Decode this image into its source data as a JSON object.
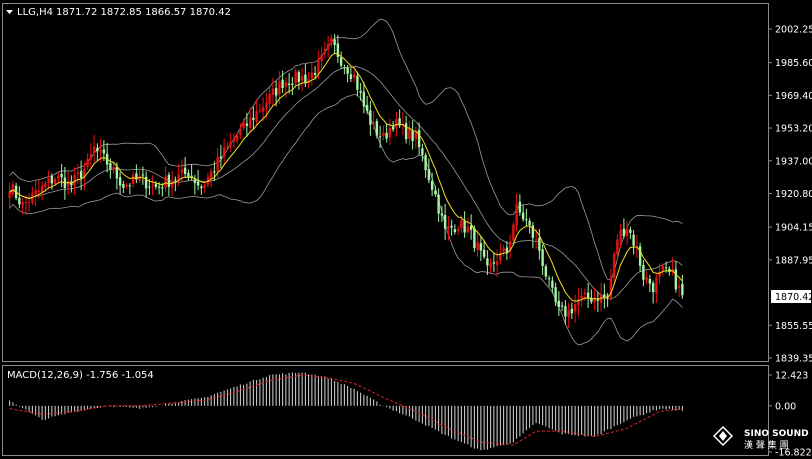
{
  "header": {
    "symbol_label": "LLG,H4",
    "ohlc": "1871.72 1872.85 1866.57 1870.42"
  },
  "macd_header": {
    "label": "MACD(12,26,9) -1.756 -1.054"
  },
  "watermark": {
    "brand": "SINO SOUND",
    "chinese": "漢 聲 集 團"
  },
  "colors": {
    "background": "#000000",
    "frame": "#8a8a8a",
    "bull": "#e81010",
    "bear": "#a6f5a6",
    "ma": "#f0e020",
    "bands": "#9a9a9a",
    "macd_hist": "#d8d8d8",
    "macd_signal": "#e02020",
    "price_box": "#ffffff"
  },
  "chart_data": [
    {
      "type": "candlestick",
      "title": "LLG,H4",
      "yticks": [
        "2002.25",
        "1985.60",
        "1969.40",
        "1953.20",
        "1937.00",
        "1920.80",
        "1904.15",
        "1887.95",
        "1870.42",
        "1855.55",
        "1839.35"
      ],
      "ylim": [
        1839.35,
        2002.25
      ],
      "current_price": "1870.42",
      "close_path": [
        [
          0,
          1925
        ],
        [
          4,
          1915
        ],
        [
          9,
          1922
        ],
        [
          14,
          1929
        ],
        [
          19,
          1925
        ],
        [
          24,
          1935
        ],
        [
          26,
          1943
        ],
        [
          30,
          1936
        ],
        [
          35,
          1925
        ],
        [
          40,
          1928
        ],
        [
          45,
          1924
        ],
        [
          50,
          1928
        ],
        [
          55,
          1931
        ],
        [
          59,
          1924
        ],
        [
          62,
          1931
        ],
        [
          66,
          1941
        ],
        [
          70,
          1950
        ],
        [
          73,
          1955
        ],
        [
          77,
          1963
        ],
        [
          80,
          1968
        ],
        [
          84,
          1976
        ],
        [
          88,
          1978
        ],
        [
          92,
          1978
        ],
        [
          95,
          1984
        ],
        [
          99,
          1995
        ],
        [
          103,
          1985
        ],
        [
          106,
          1979
        ],
        [
          109,
          1964
        ],
        [
          112,
          1953
        ],
        [
          115,
          1948
        ],
        [
          118,
          1956
        ],
        [
          122,
          1951
        ],
        [
          125,
          1948
        ],
        [
          128,
          1934
        ],
        [
          131,
          1920
        ],
        [
          134,
          1902
        ],
        [
          138,
          1906
        ],
        [
          141,
          1903
        ],
        [
          144,
          1894
        ],
        [
          147,
          1882
        ],
        [
          150,
          1889
        ],
        [
          153,
          1892
        ],
        [
          156,
          1913
        ],
        [
          159,
          1907
        ],
        [
          163,
          1893
        ],
        [
          166,
          1875
        ],
        [
          169,
          1862
        ],
        [
          172,
          1862
        ],
        [
          175,
          1868
        ],
        [
          178,
          1869
        ],
        [
          181,
          1870
        ],
        [
          184,
          1869
        ],
        [
          187,
          1899
        ],
        [
          190,
          1905
        ],
        [
          193,
          1893
        ],
        [
          195,
          1880
        ],
        [
          198,
          1875
        ],
        [
          201,
          1882
        ],
        [
          204,
          1880
        ],
        [
          207,
          1870
        ]
      ],
      "moving_average": "yellow",
      "bollinger_bands": true,
      "grid": false
    },
    {
      "type": "bar",
      "title": "MACD(12,26,9) -1.756 -1.054",
      "yticks": [
        "12.423",
        "0.00",
        "-16.822"
      ],
      "ylim": [
        -16.822,
        12.423
      ],
      "macd": -1.756,
      "signal": -1.054,
      "macd_path": [
        [
          0,
          2
        ],
        [
          10,
          -5
        ],
        [
          20,
          -2
        ],
        [
          30,
          0
        ],
        [
          40,
          -1
        ],
        [
          50,
          1
        ],
        [
          60,
          3
        ],
        [
          70,
          7
        ],
        [
          80,
          11
        ],
        [
          90,
          12
        ],
        [
          98,
          10
        ],
        [
          106,
          6
        ],
        [
          115,
          0
        ],
        [
          125,
          -5
        ],
        [
          135,
          -11
        ],
        [
          145,
          -16
        ],
        [
          155,
          -13
        ],
        [
          162,
          -6
        ],
        [
          170,
          -10
        ],
        [
          180,
          -11
        ],
        [
          190,
          -5
        ],
        [
          200,
          -1
        ],
        [
          207,
          -1.756
        ]
      ],
      "signal_path": [
        [
          0,
          -1
        ],
        [
          10,
          -3
        ],
        [
          20,
          -2
        ],
        [
          30,
          0
        ],
        [
          40,
          0
        ],
        [
          50,
          1
        ],
        [
          60,
          2
        ],
        [
          70,
          5
        ],
        [
          80,
          9
        ],
        [
          90,
          11
        ],
        [
          98,
          10
        ],
        [
          106,
          8
        ],
        [
          115,
          3
        ],
        [
          125,
          -2
        ],
        [
          135,
          -8
        ],
        [
          145,
          -13
        ],
        [
          155,
          -14
        ],
        [
          162,
          -9
        ],
        [
          170,
          -9
        ],
        [
          180,
          -11
        ],
        [
          190,
          -8
        ],
        [
          200,
          -2
        ],
        [
          207,
          -1.054
        ]
      ]
    }
  ]
}
